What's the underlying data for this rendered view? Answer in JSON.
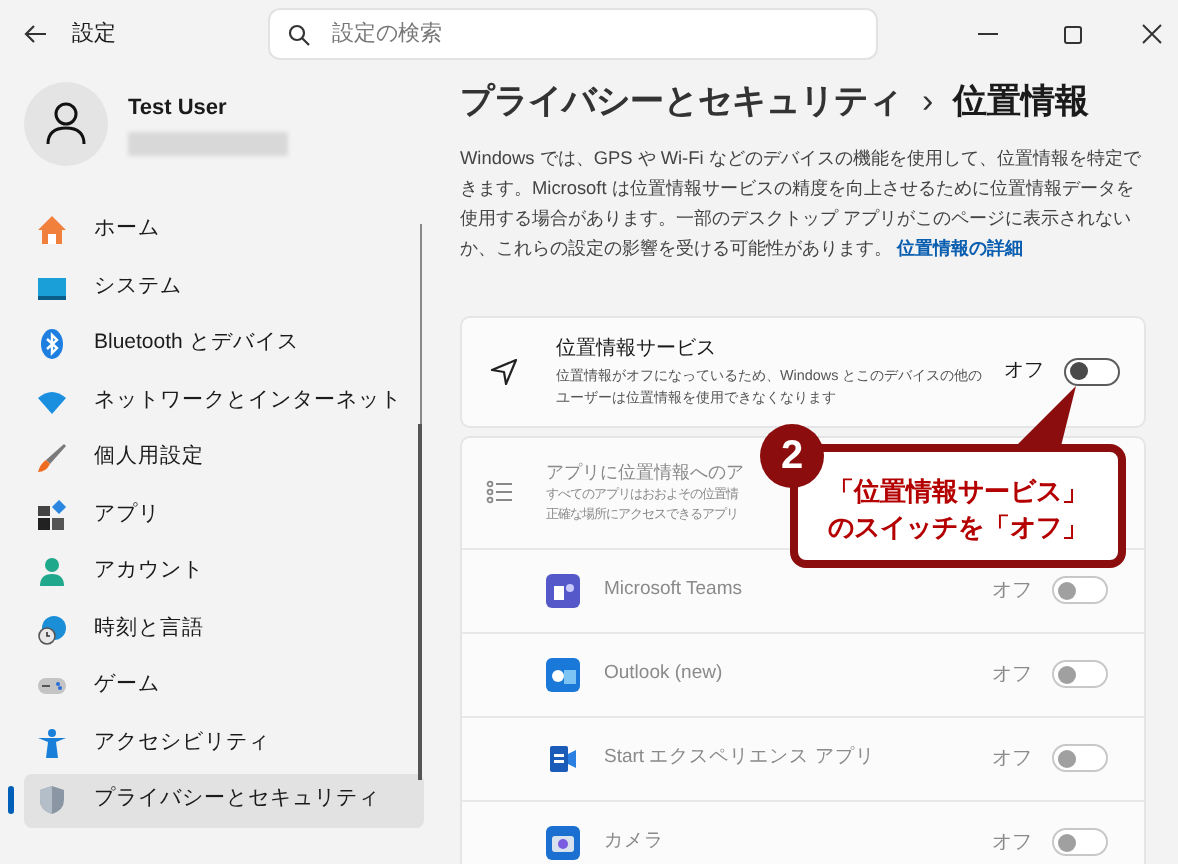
{
  "window": {
    "title": "設定"
  },
  "search": {
    "placeholder": "設定の検索"
  },
  "user": {
    "name": "Test User"
  },
  "nav": [
    {
      "label": "ホーム",
      "selected": false
    },
    {
      "label": "システム",
      "selected": false
    },
    {
      "label": "Bluetooth とデバイス",
      "selected": false
    },
    {
      "label": "ネットワークとインターネット",
      "selected": false
    },
    {
      "label": "個人用設定",
      "selected": false
    },
    {
      "label": "アプリ",
      "selected": false
    },
    {
      "label": "アカウント",
      "selected": false
    },
    {
      "label": "時刻と言語",
      "selected": false
    },
    {
      "label": "ゲーム",
      "selected": false
    },
    {
      "label": "アクセシビリティ",
      "selected": false
    },
    {
      "label": "プライバシーとセキュリティ",
      "selected": true
    }
  ],
  "breadcrumb": {
    "parent": "プライバシーとセキュリティ",
    "separator": "›",
    "current": "位置情報"
  },
  "intro": {
    "text": "Windows では、GPS や Wi-Fi などのデバイスの機能を使用して、位置情報を特定できます。Microsoft は位置情報サービスの精度を向上させるために位置情報データを使用する場合があります。一部のデスクトップ アプリがこのページに表示されないか、これらの設定の影響を受ける可能性があります。",
    "link": "位置情報の詳細"
  },
  "location_service": {
    "title": "位置情報サービス",
    "description_lines": [
      "位置情報がオフになっているため、Windows とこのデバイスの他の",
      "ユーザーは位置情報を使用できなくなります"
    ],
    "state_label": "オフ",
    "on": false
  },
  "app_access": {
    "disabled": true,
    "title": "アプリに位置情報へのア",
    "description_lines": [
      "すべてのアプリはおおよその位置情",
      "正確な場所にアクセスできるアプリ"
    ],
    "apps": [
      {
        "name": "Microsoft Teams",
        "state_label": "オフ",
        "on": false
      },
      {
        "name": "Outlook (new)",
        "state_label": "オフ",
        "on": false
      },
      {
        "name": "Start エクスペリエンス アプリ",
        "state_label": "オフ",
        "on": false
      },
      {
        "name": "カメラ",
        "state_label": "オフ",
        "on": false
      }
    ]
  },
  "callout": {
    "number": "2",
    "lines": [
      "「位置情報サービス」",
      "のスイッチを「オフ」"
    ]
  }
}
